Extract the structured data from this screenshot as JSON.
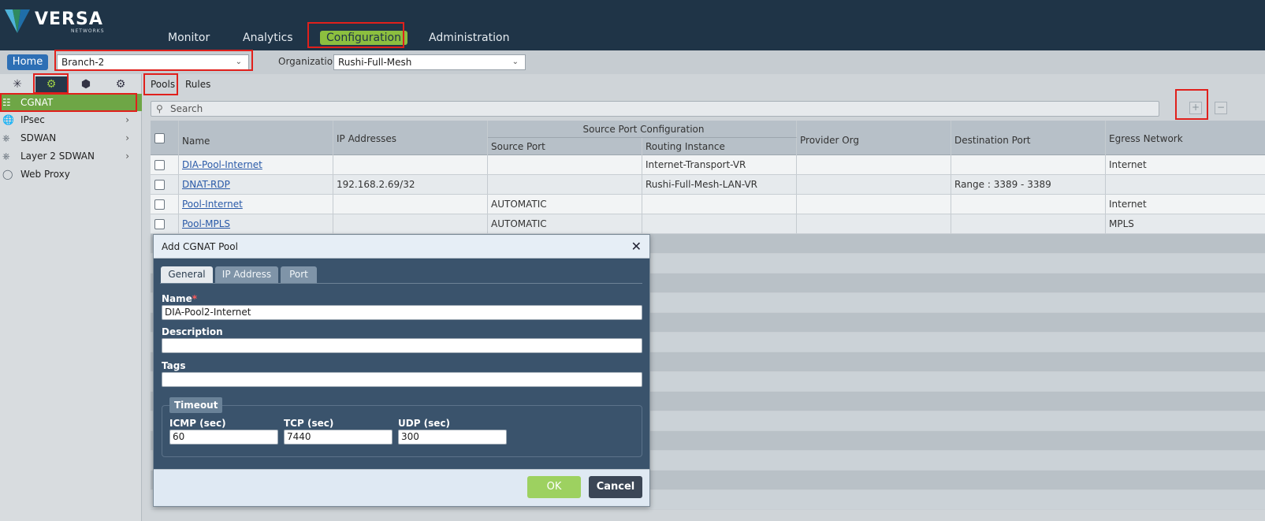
{
  "brand": {
    "name": "VERSA",
    "sub": "NETWORKS"
  },
  "nav": {
    "items": [
      {
        "label": "Monitor"
      },
      {
        "label": "Analytics"
      },
      {
        "label": "Configuration",
        "active": true
      },
      {
        "label": "Administration"
      }
    ]
  },
  "subbar": {
    "home_label": "Home",
    "appliance": "Branch-2",
    "org_label": "Organization:",
    "org_value": "Rushi-Full-Mesh"
  },
  "left_tabs": [
    "network-icon",
    "gear-icon",
    "cube-icon",
    "settings-shield-icon"
  ],
  "tree": [
    {
      "label": "CGNAT",
      "icon": "network-icon",
      "active": true
    },
    {
      "label": "IPsec",
      "icon": "globe-lock-icon",
      "expandable": true
    },
    {
      "label": "SDWAN",
      "icon": "branch-icon",
      "expandable": true
    },
    {
      "label": "Layer 2 SDWAN",
      "icon": "branch-icon",
      "expandable": true
    },
    {
      "label": "Web Proxy",
      "icon": "globe-icon"
    }
  ],
  "content_tabs": {
    "pools": "Pools",
    "rules": "Rules"
  },
  "search": {
    "placeholder": "Search"
  },
  "table": {
    "group_header": "Source Port Configuration",
    "headers": {
      "name": "Name",
      "ip": "IP Addresses",
      "source_port": "Source Port",
      "routing_instance": "Routing Instance",
      "provider_org": "Provider Org",
      "dest_port": "Destination Port",
      "egress": "Egress Network"
    },
    "rows": [
      {
        "name": "DIA-Pool-Internet",
        "ip": "",
        "source_port": "",
        "routing_instance": "Internet-Transport-VR",
        "provider_org": "",
        "dest_port": "",
        "egress": "Internet"
      },
      {
        "name": "DNAT-RDP",
        "ip": "192.168.2.69/32",
        "source_port": "",
        "routing_instance": "Rushi-Full-Mesh-LAN-VR",
        "provider_org": "",
        "dest_port": "Range : 3389 - 3389",
        "egress": ""
      },
      {
        "name": "Pool-Internet",
        "ip": "",
        "source_port": "AUTOMATIC",
        "routing_instance": "",
        "provider_org": "",
        "dest_port": "",
        "egress": "Internet"
      },
      {
        "name": "Pool-MPLS",
        "ip": "",
        "source_port": "AUTOMATIC",
        "routing_instance": "",
        "provider_org": "",
        "dest_port": "",
        "egress": "MPLS"
      }
    ]
  },
  "modal": {
    "title": "Add CGNAT Pool",
    "tabs": [
      "General",
      "IP Address",
      "Port"
    ],
    "name_label": "Name",
    "name_value": "DIA-Pool2-Internet",
    "description_label": "Description",
    "description_value": "",
    "tags_label": "Tags",
    "tags_value": "",
    "timeout_legend": "Timeout",
    "icmp_label": "ICMP (sec)",
    "icmp_value": "60",
    "tcp_label": "TCP (sec)",
    "tcp_value": "7440",
    "udp_label": "UDP (sec)",
    "udp_value": "300",
    "ok_label": "OK",
    "cancel_label": "Cancel"
  },
  "colors": {
    "header": "#1f3447",
    "accent": "#8cbf3f",
    "modal": "#3a536c",
    "annotation": "#e0201c"
  }
}
